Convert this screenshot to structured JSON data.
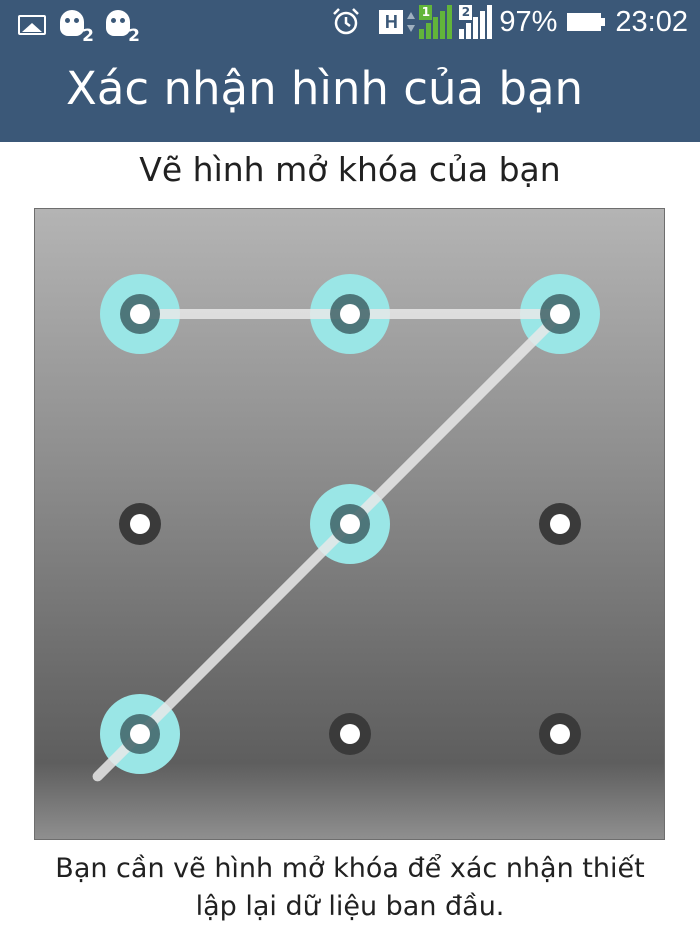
{
  "status_bar": {
    "notification_icons": [
      "image-icon",
      "zombie-game-icon",
      "zombie-game-icon"
    ],
    "zombie_badge": "2",
    "network_type": "H",
    "sim1_label": "1",
    "sim2_label": "2",
    "battery_percent": "97%",
    "time": "23:02"
  },
  "header": {
    "title": "Xác nhận hình của bạn"
  },
  "pattern": {
    "prompt": "Vẽ hình mở khóa của bạn",
    "grid_size": 3,
    "selected_dots": [
      0,
      1,
      2,
      4,
      6
    ],
    "path_order": [
      0,
      1,
      2,
      4,
      6
    ],
    "selected_color": "#9ae6e6",
    "line_color": "#e8e8e8"
  },
  "footer": {
    "line1": "Bạn cần vẽ hình mở khóa để xác nhận thiết",
    "line2": "lập lại dữ liệu ban đầu."
  }
}
